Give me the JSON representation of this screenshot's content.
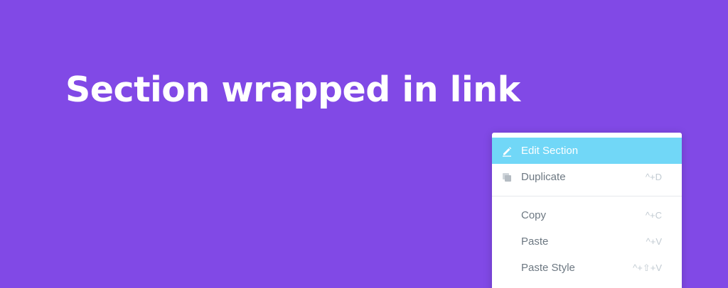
{
  "colors": {
    "background": "#8149e6",
    "menu_highlight": "#71d7f7",
    "menu_text": "#6d7882",
    "shortcut_text": "#c2cbd2"
  },
  "page": {
    "heading": "Section wrapped in link"
  },
  "context_menu": {
    "items": [
      {
        "label": "Edit Section",
        "shortcut": "",
        "icon": "pencil-icon",
        "active": true
      },
      {
        "label": "Duplicate",
        "shortcut": "^+D",
        "icon": "duplicate-icon",
        "active": false
      },
      {
        "label": "Copy",
        "shortcut": "^+C",
        "icon": "",
        "active": false
      },
      {
        "label": "Paste",
        "shortcut": "^+V",
        "icon": "",
        "active": false
      },
      {
        "label": "Paste Style",
        "shortcut": "^+⇧+V",
        "icon": "",
        "active": false
      }
    ]
  }
}
